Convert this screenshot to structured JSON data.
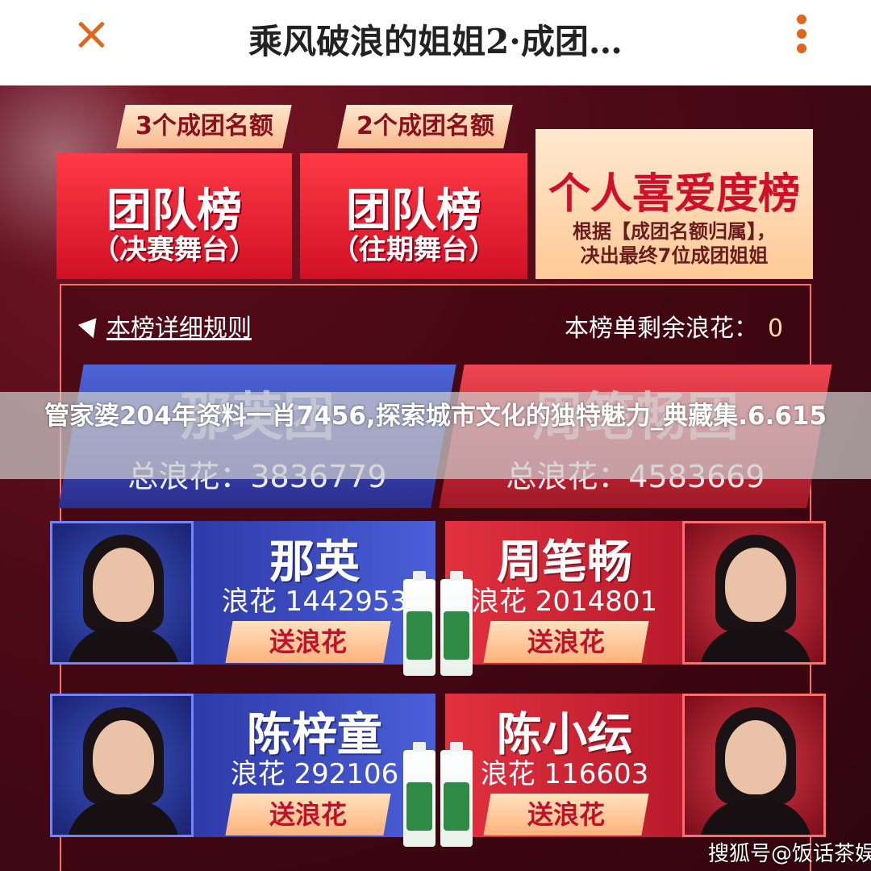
{
  "header": {
    "title": "乘风破浪的姐姐2·成团…"
  },
  "tabs": [
    {
      "tag": "3个成团名额",
      "main": "团队榜",
      "sub": "（决赛舞台）"
    },
    {
      "tag": "2个成团名额",
      "main": "团队榜",
      "sub": "（往期舞台）"
    },
    {
      "main": "个人喜爱度榜",
      "desc_line1": "根据【成团名额归属】，",
      "desc_line2": "决出最终7位成团姐姐"
    }
  ],
  "board": {
    "rules_link": "本榜详细规则",
    "remaining_label": "本榜单剩余浪花：",
    "remaining_value": "0"
  },
  "teams": [
    {
      "name": "那英团",
      "total": "总浪花：3836779",
      "color": "#3a49c4"
    },
    {
      "name": "周笔畅团",
      "total": "总浪花：4583669",
      "color": "#d8283a"
    }
  ],
  "contestants": [
    {
      "name": "那英",
      "score": "浪花 1442953",
      "button": "送浪花",
      "team": "blue"
    },
    {
      "name": "周笔畅",
      "score": "浪花 2014801",
      "button": "送浪花",
      "team": "red"
    },
    {
      "name": "陈梓童",
      "score": "浪花 292106",
      "button": "送浪花",
      "team": "blue"
    },
    {
      "name": "陈小纭",
      "score": "浪花 116603",
      "button": "送浪花",
      "team": "red"
    }
  ],
  "banner": {
    "text": "管家婆204年资料一肖7456,探索城市文化的独特魅力_典藏集.6.615"
  },
  "watermark": "搜狐号@饭话茶娱"
}
